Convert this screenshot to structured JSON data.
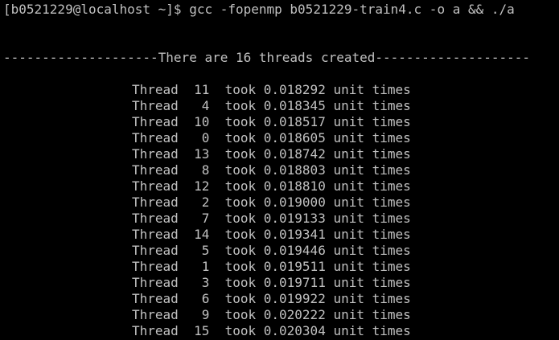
{
  "terminal": {
    "text_color": "#c0c0c0",
    "background": "#000000",
    "command_line": "[b0521229@localhost ~]$ gcc -fopenmp b0521229-train4.c -o a && ./a",
    "separator_line": "--------------------There are 16 threads created--------------------",
    "thread_rows": [
      "Thread  11  took 0.018292 unit times",
      "Thread   4  took 0.018345 unit times",
      "Thread  10  took 0.018517 unit times",
      "Thread   0  took 0.018605 unit times",
      "Thread  13  took 0.018742 unit times",
      "Thread   8  took 0.018803 unit times",
      "Thread  12  took 0.018810 unit times",
      "Thread   2  took 0.019000 unit times",
      "Thread   7  took 0.019133 unit times",
      "Thread  14  took 0.019341 unit times",
      "Thread   5  took 0.019446 unit times",
      "Thread   1  took 0.019511 unit times",
      "Thread   3  took 0.019711 unit times",
      "Thread   6  took 0.019922 unit times",
      "Thread   9  took 0.020222 unit times",
      "Thread  15  took 0.020304 unit times"
    ]
  }
}
